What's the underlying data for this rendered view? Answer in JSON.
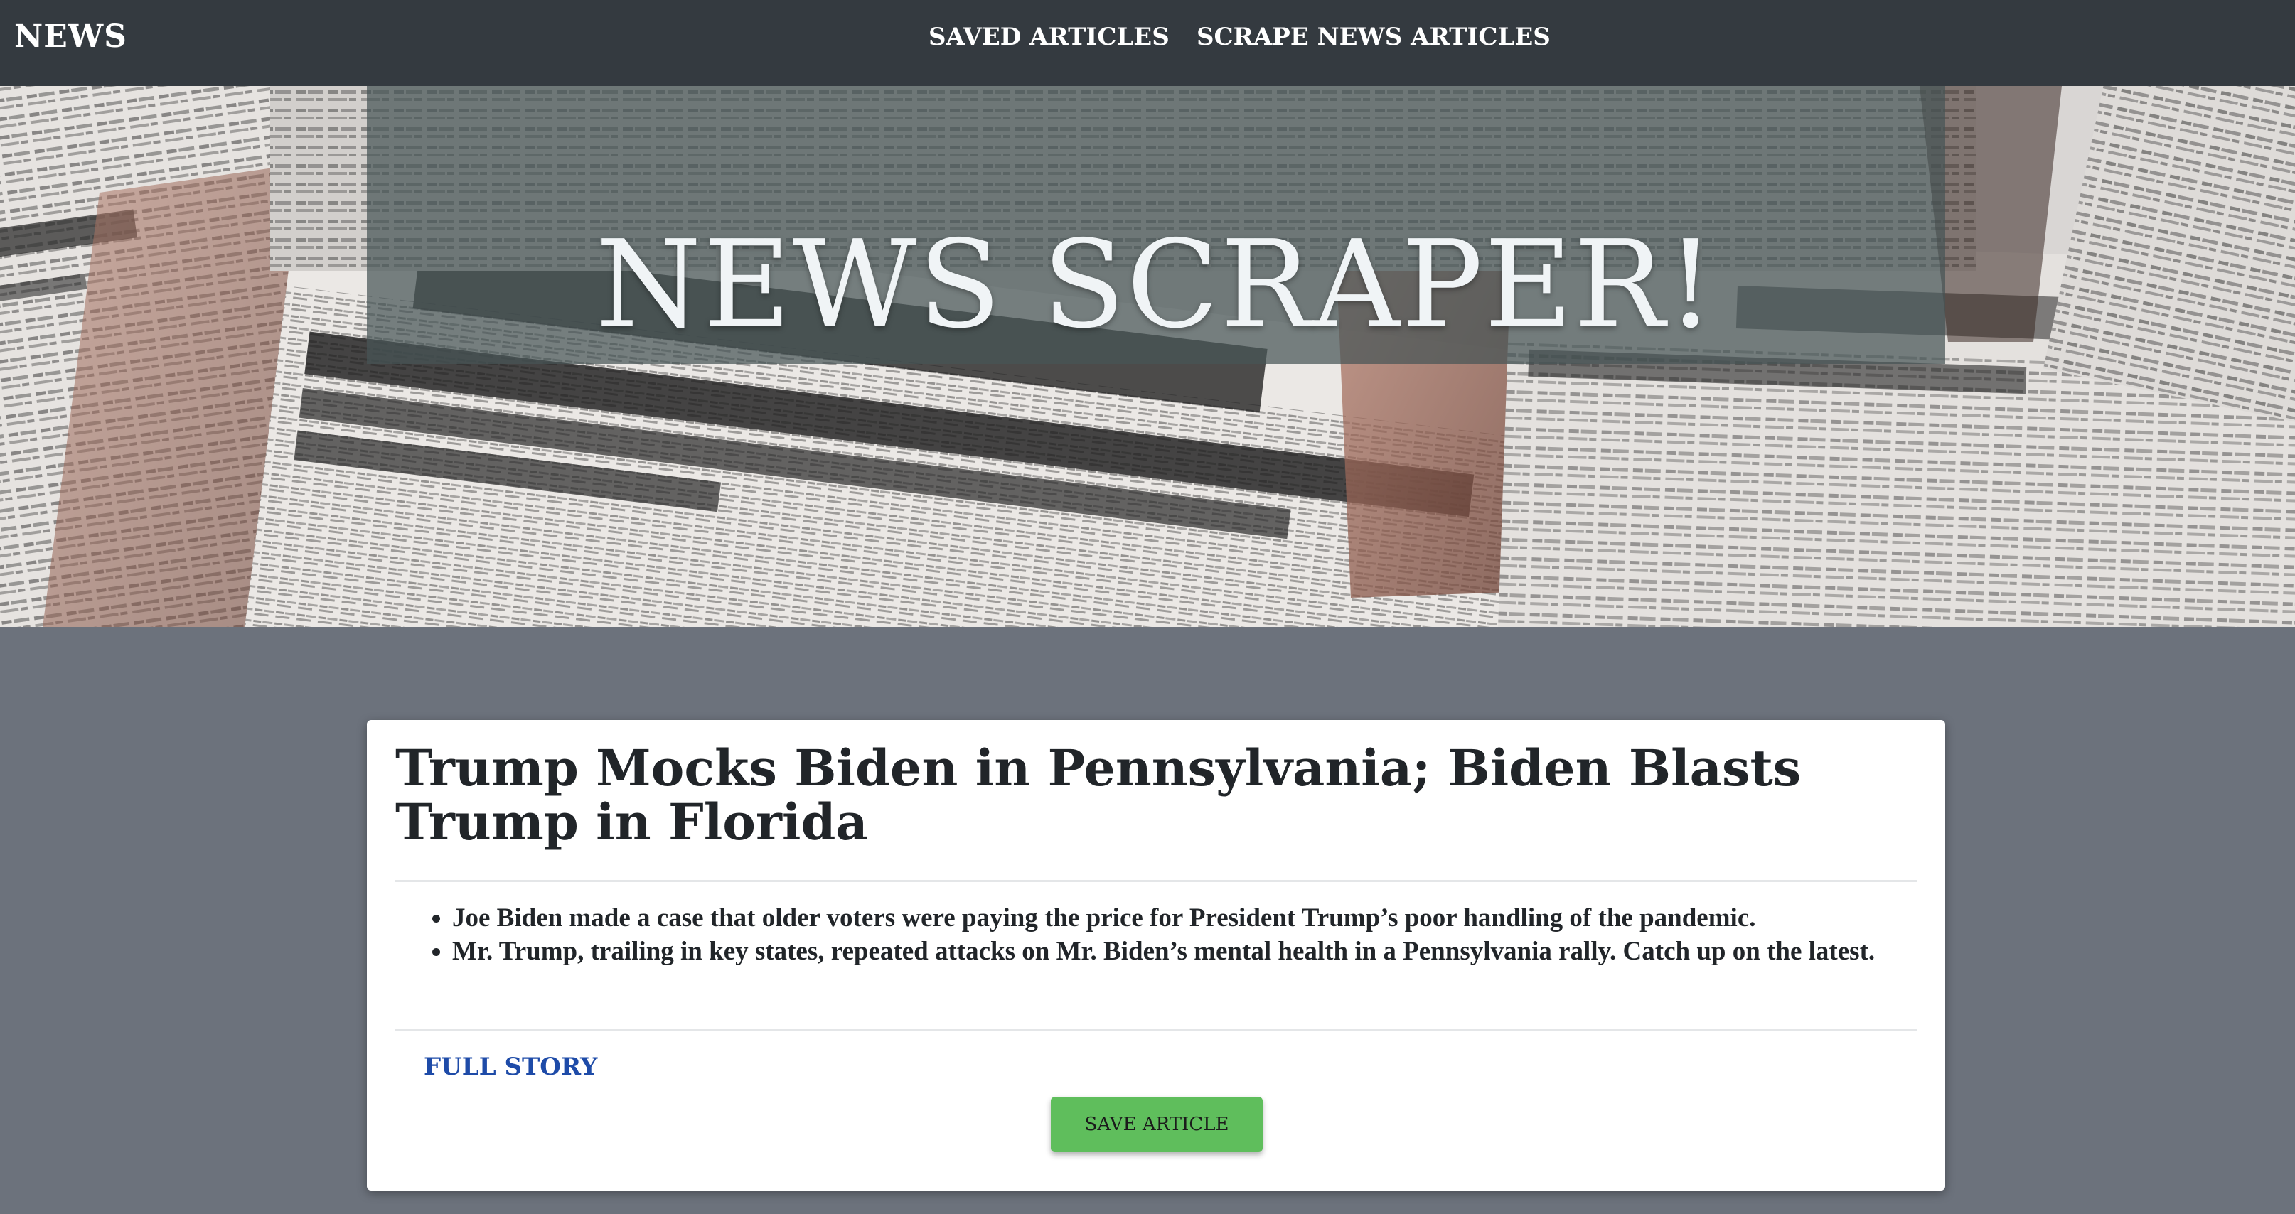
{
  "navbar": {
    "brand": "NEWS",
    "links": [
      {
        "label": "SAVED ARTICLES"
      },
      {
        "label": "SCRAPE NEWS ARTICLES"
      }
    ]
  },
  "hero": {
    "title": "NEWS SCRAPER!"
  },
  "article": {
    "title": "Trump Mocks Biden in Pennsylvania; Biden Blasts Trump in Florida",
    "summary": [
      "Joe Biden made a case that older voters were paying the price for President Trump’s poor handling of the pandemic.",
      "Mr. Trump, trailing in key states, repeated attacks on Mr. Biden’s mental health in a Pennsylvania rally. Catch up on the latest."
    ],
    "link_label": "FULL STORY",
    "save_label": "SAVE ARTICLE"
  },
  "colors": {
    "navbar": "#343a40",
    "page_background": "#6c727c",
    "card": "#ffffff",
    "link": "#1e4ba8",
    "save_button": "#5fbe5c"
  }
}
